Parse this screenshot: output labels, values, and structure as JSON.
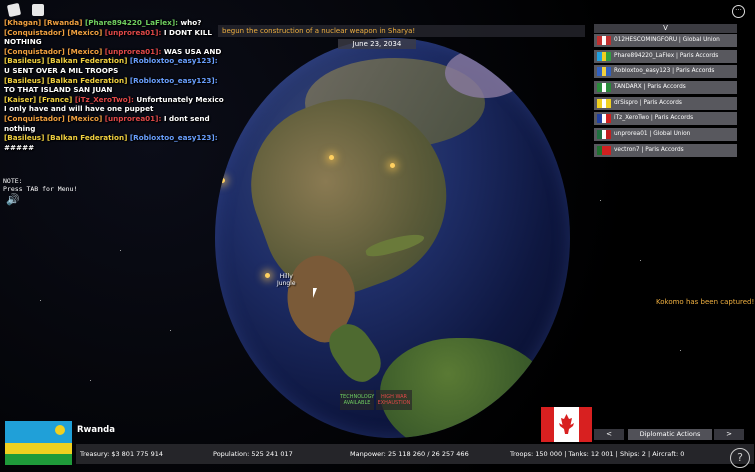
{
  "banner": {
    "text": "begun the construction of a nuclear weapon in Sharya!"
  },
  "date": "June 23, 2034",
  "chat": [
    {
      "tag": "[Khagan]",
      "tag_color": "o",
      "faction": "[Rwanda]",
      "faction_color": "o",
      "user": "[Phare894220_LaFlex]:",
      "user_color": "g",
      "msg": "who?"
    },
    {
      "tag": "[Conquistador]",
      "tag_color": "o",
      "faction": "[Mexico]",
      "faction_color": "o",
      "user": "[unprorea01]:",
      "user_color": "r",
      "msg": "I DONT KILL NOTHING"
    },
    {
      "tag": "[Conquistador]",
      "tag_color": "o",
      "faction": "[Mexico]",
      "faction_color": "o",
      "user": "[unprorea01]:",
      "user_color": "r",
      "msg": "WAS USA AND"
    },
    {
      "tag": "[Basileus]",
      "tag_color": "y",
      "faction": "[Balkan Federation]",
      "faction_color": "y",
      "user": "[Robloxtoo_easy123]:",
      "user_color": "b",
      "msg": "U SENT OVER A MIL TROOPS"
    },
    {
      "tag": "[Basileus]",
      "tag_color": "y",
      "faction": "[Balkan Federation]",
      "faction_color": "y",
      "user": "[Robloxtoo_easy123]:",
      "user_color": "b",
      "msg": "TO THAT ISLAND SAN JUAN"
    },
    {
      "tag": "[Kaiser]",
      "tag_color": "y",
      "faction": "[France]",
      "faction_color": "y",
      "user": "[iTz_XeroTwo]:",
      "user_color": "r",
      "msg": "Unfortunately Mexico I only have and will have one puppet"
    },
    {
      "tag": "[Conquistador]",
      "tag_color": "o",
      "faction": "[Mexico]",
      "faction_color": "o",
      "user": "[unprorea01]:",
      "user_color": "r",
      "msg": "I dont send nothing"
    },
    {
      "tag": "[Basileus]",
      "tag_color": "y",
      "faction": "[Balkan Federation]",
      "faction_color": "y",
      "user": "[Robloxtoo_easy123]:",
      "user_color": "b",
      "msg": "#####"
    }
  ],
  "note": {
    "line1": "NOTE:",
    "line2": "Press TAB for Menu!"
  },
  "player_list": {
    "toggle": "V",
    "players": [
      {
        "name": "012HESCOMINGFORU",
        "alliance": "Global Union",
        "flag": [
          "#c03030",
          "#fff",
          "#c03030"
        ]
      },
      {
        "name": "Phare894220_LaFlex",
        "alliance": "Paris Accords",
        "flag": [
          "#20a0e0",
          "#f0d020",
          "#30a040"
        ]
      },
      {
        "name": "Robloxtoo_easy123",
        "alliance": "Paris Accords",
        "flag": [
          "#3060c0",
          "#f0d040",
          "#3060c0"
        ]
      },
      {
        "name": "TANDARX",
        "alliance": "Paris Accords",
        "flag": [
          "#2a8a3a",
          "#fff",
          "#2a8a3a"
        ]
      },
      {
        "name": "drSispro",
        "alliance": "Paris Accords",
        "flag": [
          "#f0d020",
          "#fff",
          "#f0d020"
        ]
      },
      {
        "name": "iTz_XeroTwo",
        "alliance": "Paris Accords",
        "flag": [
          "#2040a0",
          "#fff",
          "#d02020"
        ]
      },
      {
        "name": "unprorea01",
        "alliance": "Global Union",
        "flag": [
          "#207040",
          "#fff",
          "#c02020"
        ]
      },
      {
        "name": "vectron7",
        "alliance": "Paris Accords",
        "flag": [
          "#207030",
          "#d02020",
          "#d02020"
        ]
      }
    ]
  },
  "map_labels": {
    "region1": "Hilly",
    "region2": "Jungle"
  },
  "event": "Kokomo has been captured!",
  "status_tags": {
    "tech_line1": "TECHNOLOGY",
    "tech_line2": "AVAILABLE",
    "war_line1": "HIGH WAR",
    "war_line2": "EXHAUSTION"
  },
  "country": {
    "name": "Rwanda"
  },
  "diplomacy": {
    "prev": "<",
    "label": "Diplomatic Actions",
    "next": ">"
  },
  "stats": {
    "treasury": "Treasury:  $3 801 775 914",
    "population": "Population: 525 241 017",
    "manpower": "Manpower:  25 118 260  /  26 257 466",
    "military": "Troops: 150 000  |  Tanks: 12 001  |  Ships: 2  |  Aircraft: 0"
  },
  "help": "?"
}
